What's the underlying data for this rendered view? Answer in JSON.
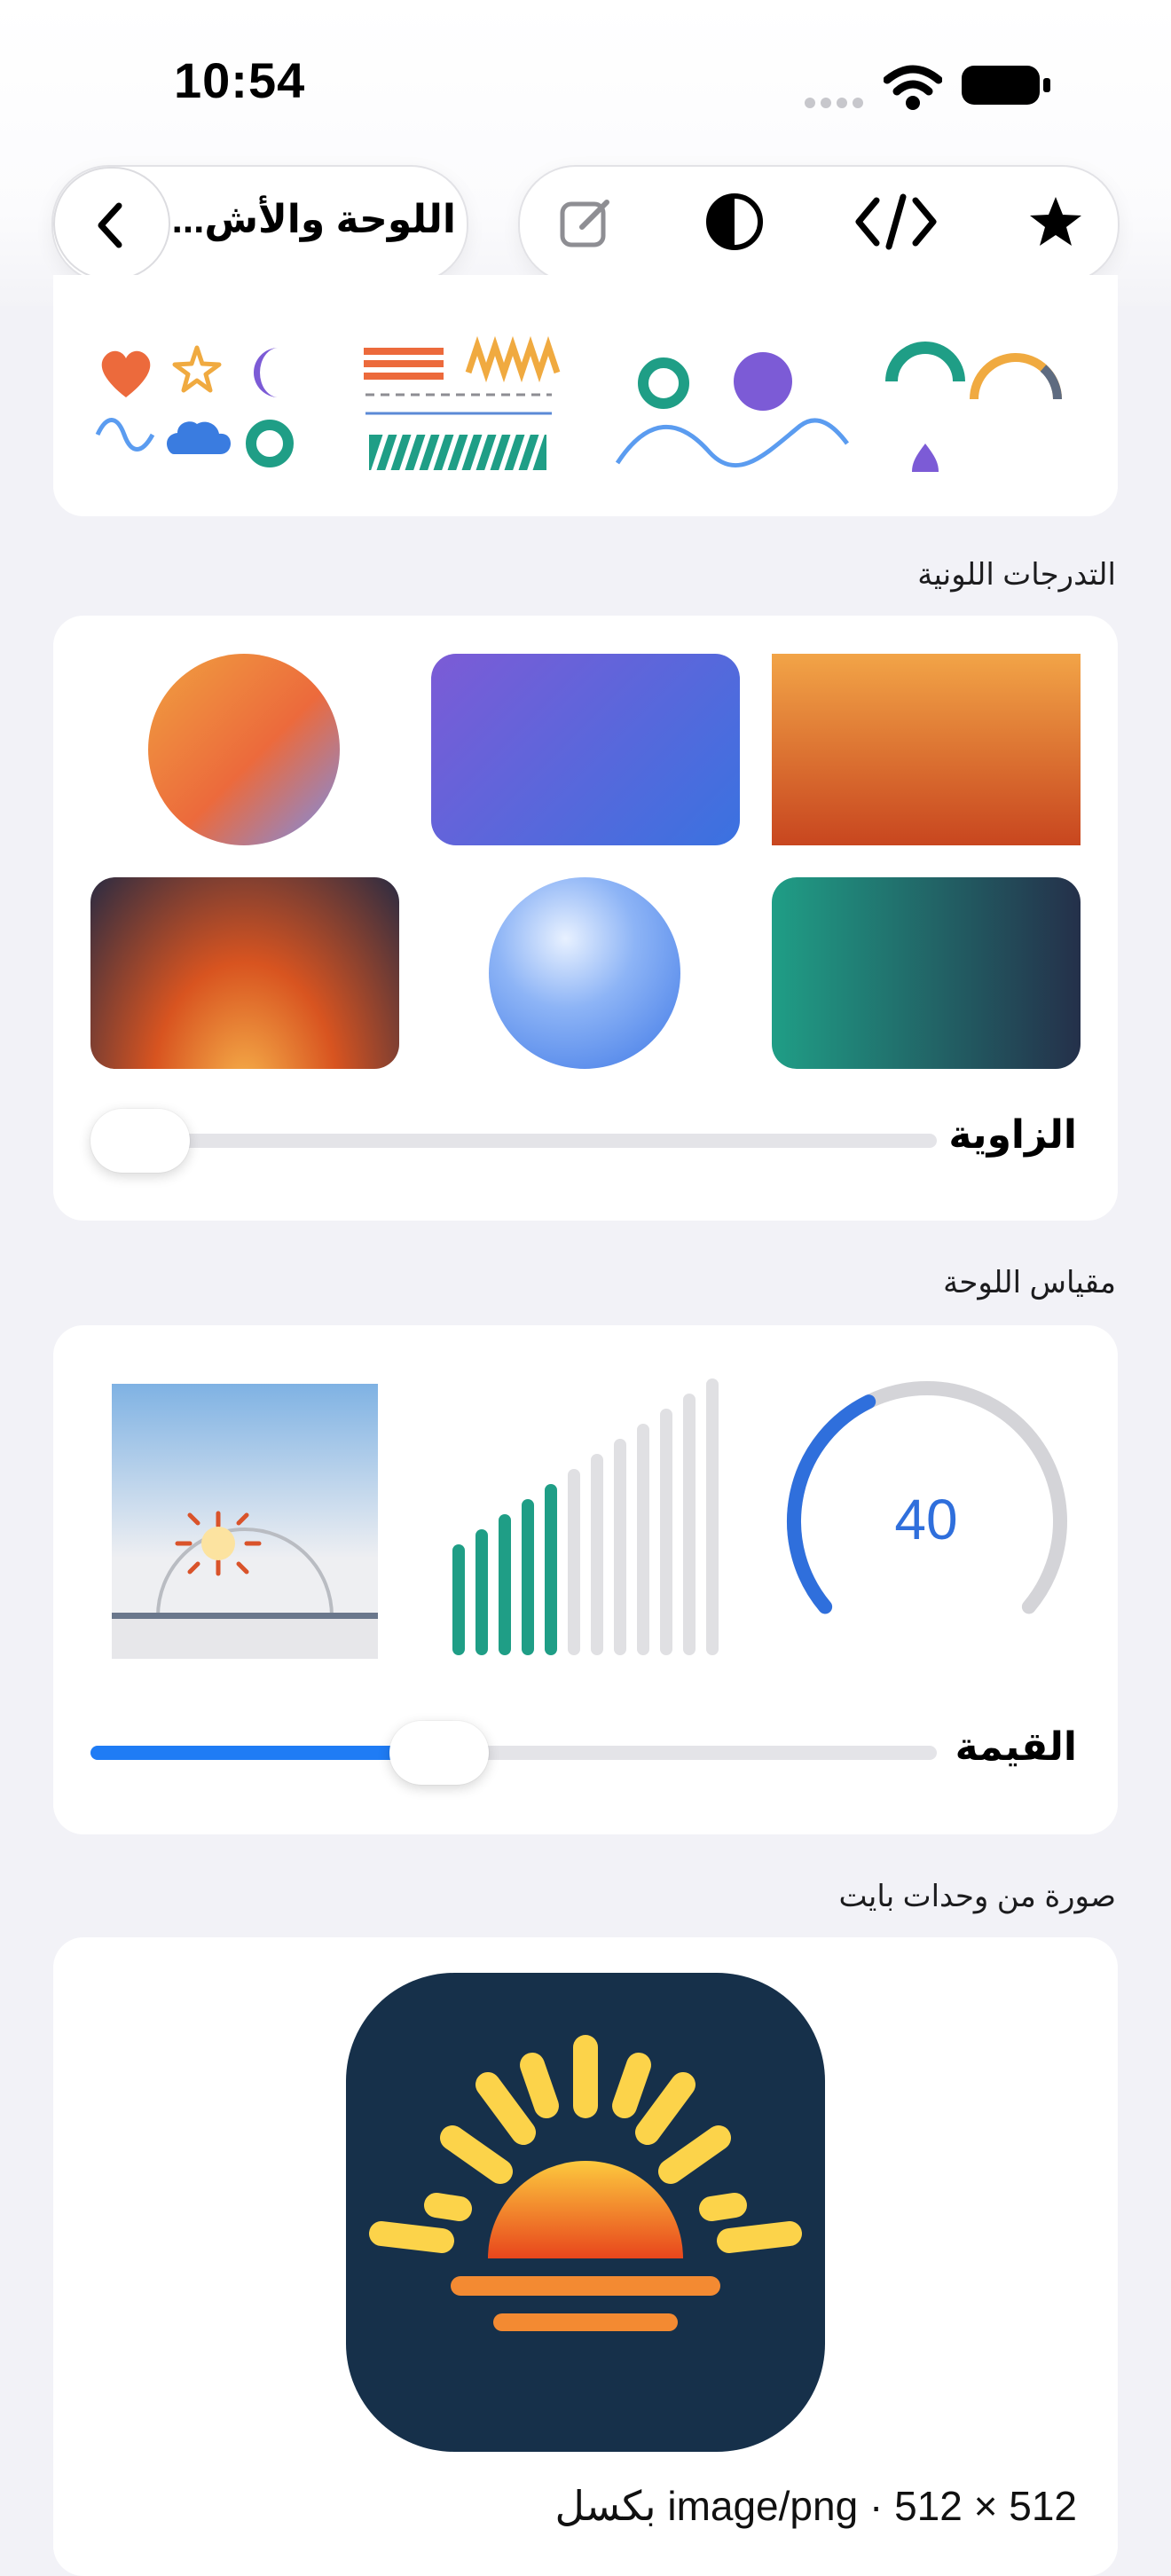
{
  "status_bar": {
    "time": "10:54"
  },
  "nav": {
    "title": "اللوحة والأش...",
    "back_icon": "chevron-left-icon",
    "actions": [
      "star-icon",
      "code-icon",
      "contrast-icon",
      "edit-icon"
    ]
  },
  "shapes_section": {
    "symbols": [
      "heart-icon",
      "star-icon",
      "moon-icon",
      "wave-icon",
      "cloud-icon",
      "ring-icon"
    ]
  },
  "gradients_section": {
    "title": "التدرجات اللونية",
    "angle_label": "الزاوية",
    "angle_value_fraction": 0.0
  },
  "gauge_section": {
    "title": "مقياس اللوحة",
    "gauge_value": "40",
    "value_label": "القيمة",
    "value_fraction": 0.4,
    "bars_filled": 5,
    "bars_total": 12
  },
  "image_section": {
    "title": "صورة من وحدات بايت",
    "caption": "512 × 512 · image/png بكسل"
  },
  "colors": {
    "accent": "#1f7cf5",
    "teal": "#1f9e86",
    "orange": "#ec6a3c",
    "purple": "#7c5bd6",
    "gauge_blue": "#2f6fdc",
    "icon_bg": "#16304a"
  }
}
